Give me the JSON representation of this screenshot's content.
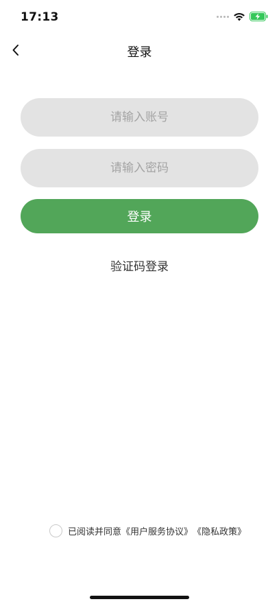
{
  "status_bar": {
    "time": "17:13",
    "wifi_icon": "wifi-icon",
    "battery_icon": "battery-charging-icon",
    "battery_color": "#34c759"
  },
  "nav": {
    "back_icon": "chevron-left-icon",
    "title": "登录"
  },
  "form": {
    "account_placeholder": "请输入账号",
    "password_placeholder": "请输入密码",
    "login_button": "登录",
    "sms_login_link": "验证码登录"
  },
  "agreement": {
    "checked": false,
    "prefix": "已阅读并同意",
    "user_agreement": "《用户服务协议》",
    "privacy_policy": "《隐私政策》"
  },
  "colors": {
    "primary_green": "#52a659",
    "input_background": "#e3e3e3",
    "placeholder": "#a4a4a4"
  }
}
